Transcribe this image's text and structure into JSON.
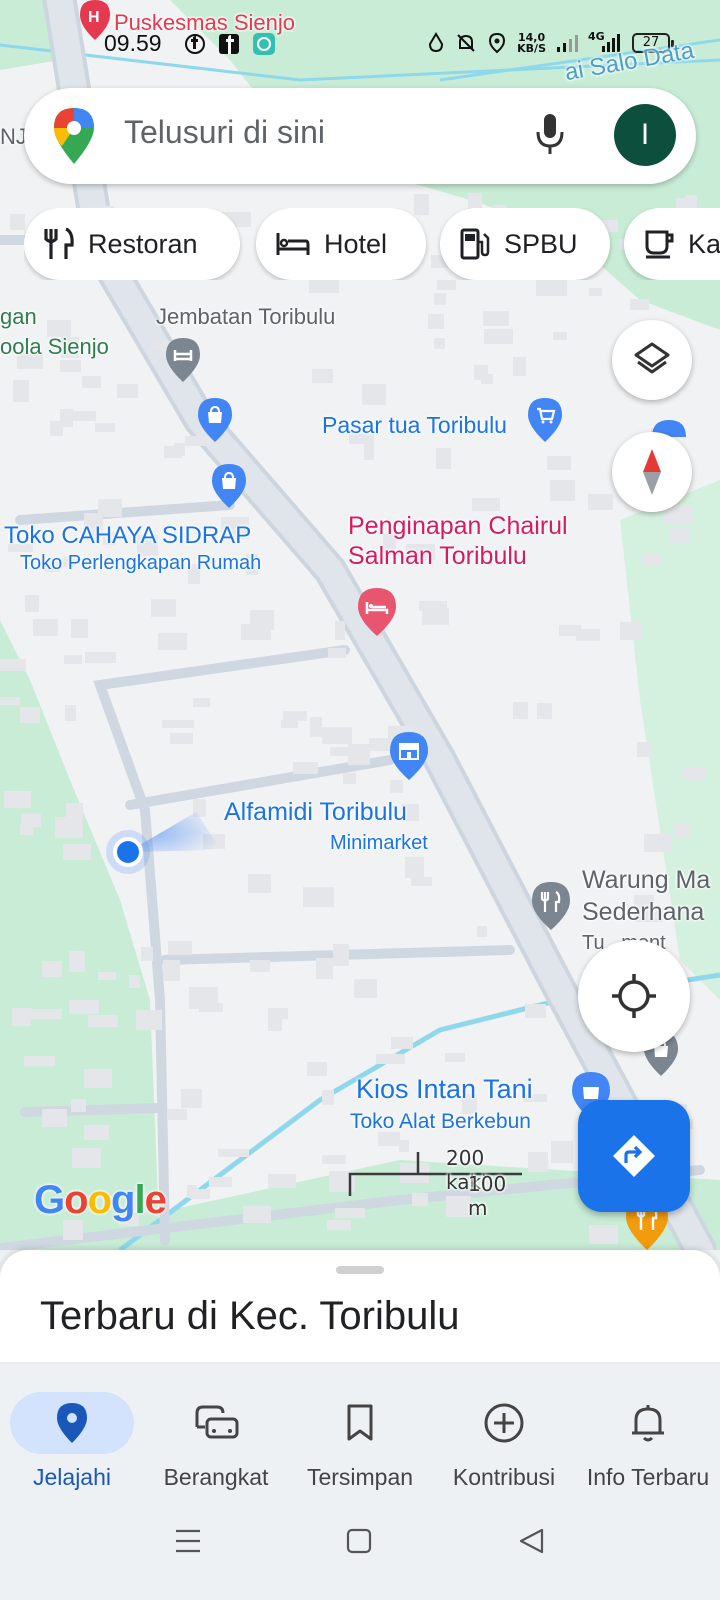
{
  "status_bar": {
    "time": "09.59",
    "net_speed_value": "14,0",
    "net_speed_unit": "KB/S",
    "network_type": "4G",
    "battery_level": "27",
    "app_icons": [
      "facebook-icon",
      "facebook-square-icon",
      "chat-bubble-icon"
    ],
    "system_icons": [
      "water-drop-icon",
      "bell-muted-icon",
      "location-icon",
      "signal-icon",
      "signal-4g-icon"
    ]
  },
  "search": {
    "placeholder": "Telusuri di sini",
    "avatar_letter": "I"
  },
  "chips": [
    {
      "label": "Restoran",
      "icon": "restaurant-icon"
    },
    {
      "label": "Hotel",
      "icon": "hotel-icon"
    },
    {
      "label": "SPBU",
      "icon": "gas-station-icon"
    },
    {
      "label": "Ka",
      "icon": "cafe-icon"
    }
  ],
  "map": {
    "places": [
      {
        "name": "Puskesmas Sienjo",
        "kind": "hospital"
      },
      {
        "name": "Jembatan Toribulu",
        "kind": "landmark"
      },
      {
        "name": "Pasar tua Toribulu",
        "kind": "market"
      },
      {
        "name": "Toko CAHAYA SIDRAP",
        "subtitle": "Toko Perlengkapan Rumah",
        "kind": "shop"
      },
      {
        "name": "Penginapan Chairul Salman Toribulu",
        "line1": "Penginapan Chairul",
        "line2": "Salman Toribulu",
        "kind": "hotel"
      },
      {
        "name": "Alfamidi Toribulu",
        "subtitle": "Minimarket",
        "kind": "store"
      },
      {
        "name": "Warung Ma",
        "line2": "Sederhana",
        "line3": "Tu...ment",
        "kind": "restaurant"
      },
      {
        "name": "Kios Intan Tani",
        "subtitle": "Toko Alat Berkebun",
        "kind": "shop"
      }
    ],
    "edge_labels": {
      "top_right_water": "ai Salo Data",
      "left_top": "NJ",
      "left_mid1": "gan",
      "left_mid2": "oola Sienjo"
    },
    "scale": {
      "feet": "200 kaki",
      "meters": "100 m"
    },
    "attribution": "Google",
    "colors": {
      "road": "#cfd8e0",
      "green": "#c8ecd6",
      "water": "#8fd8ec",
      "accent": "#1a73e8"
    }
  },
  "sheet": {
    "title": "Terbaru di Kec. Toribulu"
  },
  "bottom_nav": [
    {
      "label": "Jelajahi",
      "icon": "explore-pin-icon",
      "active": true
    },
    {
      "label": "Berangkat",
      "icon": "commute-icon",
      "active": false
    },
    {
      "label": "Tersimpan",
      "icon": "bookmark-icon",
      "active": false
    },
    {
      "label": "Kontribusi",
      "icon": "add-circle-icon",
      "active": false
    },
    {
      "label": "Info Terbaru",
      "icon": "bell-icon",
      "active": false
    }
  ],
  "system_nav": [
    "menu-icon",
    "home-square-icon",
    "back-triangle-icon"
  ]
}
